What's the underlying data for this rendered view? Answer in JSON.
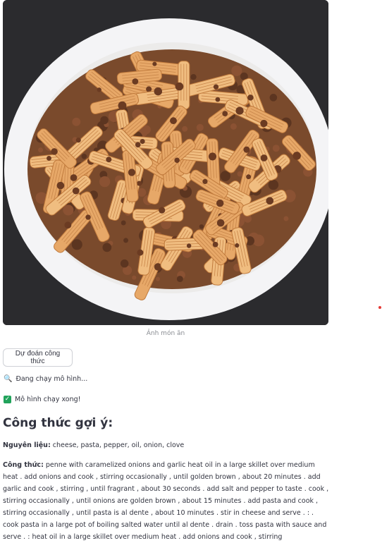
{
  "image": {
    "caption": "Ảnh món ăn"
  },
  "predict_button": "Dự đoán công thức",
  "status_running": {
    "icon": "magnifier-icon",
    "text": "Đang chạy mô hình..."
  },
  "status_done": {
    "icon": "check-icon",
    "text": "Mô hình chạy xong!"
  },
  "heading": "Công thức gợi ý:",
  "ingredients": {
    "label": "Nguyên liệu:",
    "text": "cheese, pasta, pepper, oil, onion, clove"
  },
  "recipe": {
    "label": "Công thức:",
    "text": "penne with caramelized onions and garlic heat oil in a large skillet over medium heat . add onions and cook , stirring occasionally , until golden brown , about 20 minutes . add garlic and cook , stirring , until fragrant , about 30 seconds . add salt and pepper to taste . cook , stirring occasionally , until onions are golden brown , about 15 minutes . add pasta and cook , stirring occasionally , until pasta is al dente , about 10 minutes . stir in cheese and serve . : . cook pasta in a large pot of boiling salted water until al dente . drain . toss pasta with sauce and serve . : heat oil in a large skillet over medium heat . add onions and cook , stirring"
  },
  "colors": {
    "accent_success": "#21a35b",
    "text": "#31333f",
    "caption": "#8a8d93"
  }
}
